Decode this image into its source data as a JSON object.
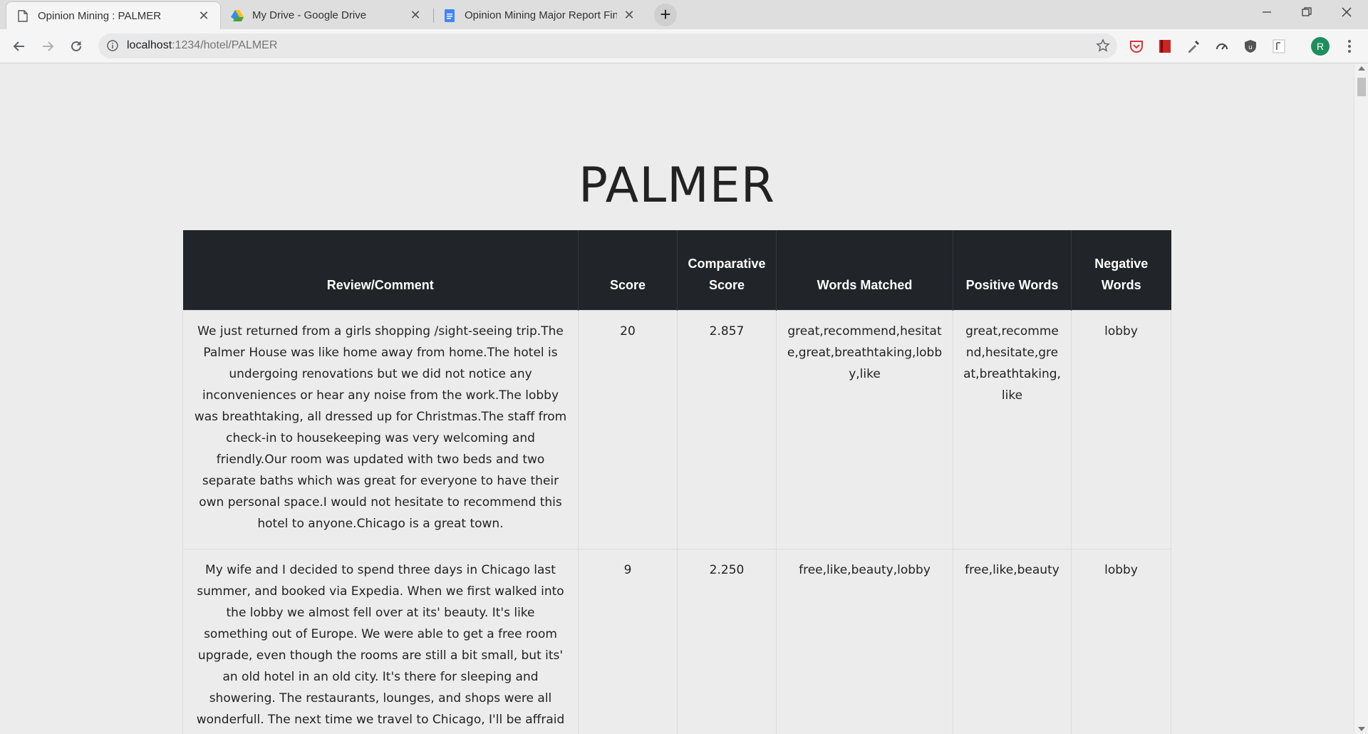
{
  "browser": {
    "tabs": [
      {
        "title": "Opinion Mining : PALMER",
        "icon": "page-icon",
        "active": true
      },
      {
        "title": "My Drive - Google Drive",
        "icon": "google-drive-icon",
        "active": false
      },
      {
        "title": "Opinion Mining Major Report Fin",
        "icon": "google-docs-icon",
        "active": false
      }
    ],
    "url_host": "localhost",
    "url_rest": ":1234/hotel/PALMER",
    "profile_initial": "R"
  },
  "page": {
    "title": "PALMER"
  },
  "table": {
    "headers": [
      "Review/Comment",
      "Score",
      "Comparative Score",
      "Words Matched",
      "Positive Words",
      "Negative Words"
    ],
    "rows": [
      {
        "review": "We just returned from a girls shopping /sight-seeing trip.The Palmer House was like home away from home.The hotel is undergoing renovations but we did not notice any inconveniences or hear any noise from the work.The lobby was breathtaking, all dressed up for Christmas.The staff from check-in to housekeeping was very welcoming and friendly.Our room was updated with two beds and two separate baths which was great for everyone to have their own personal space.I would not hesitate to recommend this hotel to anyone.Chicago is a great town.",
        "score": "20",
        "comparative": "2.857",
        "matched": "great,recommend,hesitate,great,breathtaking,lobby,like",
        "positive": "great,recommend,hesitate,great,breathtaking,like",
        "negative": "lobby"
      },
      {
        "review": "My wife and I decided to spend three days in Chicago last summer, and booked via Expedia. When we first walked into the lobby we almost fell over at its' beauty. It's like something out of Europe. We were able to get a free room upgrade, even though the rooms are still a bit small, but its' an old hotel in an old city. It's there for sleeping and showering. The restaurants, lounges, and shops were all wonderfull. The next time we travel to Chicago, I'll be affraid to stay anywhere other than the Palmer House Hilton",
        "score": "9",
        "comparative": "2.250",
        "matched": "free,like,beauty,lobby",
        "positive": "free,like,beauty",
        "negative": "lobby"
      }
    ]
  }
}
